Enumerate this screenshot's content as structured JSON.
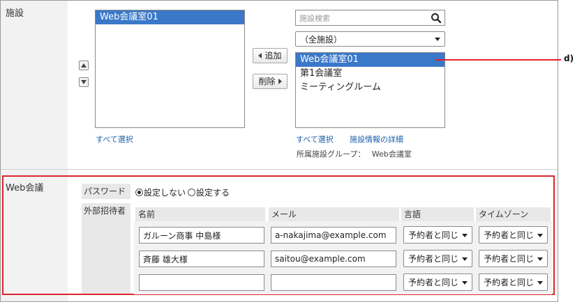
{
  "facility": {
    "row_label": "施設",
    "selected_list": [
      "Web会議室01"
    ],
    "select_all_left": "すべて選択",
    "add_label": "追加",
    "remove_label": "削除",
    "search_placeholder": "施設検索",
    "group_select": "（全施設）",
    "available_list": [
      "Web会議室01",
      "第1会議室",
      "ミーティングルーム"
    ],
    "select_all_right": "すべて選択",
    "facility_details": "施設情報の詳細",
    "group_info_label": "所属施設グループ：",
    "group_info_value": "Web会議室"
  },
  "callout": {
    "label": "d)"
  },
  "web_meeting": {
    "row_label": "Web会議",
    "password": {
      "label": "パスワード",
      "options": [
        "設定しない",
        "設定する"
      ],
      "selected": "設定しない"
    },
    "guests": {
      "label": "外部招待者",
      "headers": [
        "名前",
        "メール",
        "言語",
        "タイムゾーン"
      ],
      "rows": [
        {
          "name": "ガルーン商事 中島様",
          "email": "a-nakajima@example.com",
          "language": "予約者と同じ",
          "timezone": "予約者と同じ"
        },
        {
          "name": "斉藤 雄大様",
          "email": "saitou@example.com",
          "language": "予約者と同じ",
          "timezone": "予約者と同じ"
        },
        {
          "name": "",
          "email": "",
          "language": "予約者と同じ",
          "timezone": "予約者と同じ"
        }
      ]
    }
  },
  "colors": {
    "selection": "#3a78c8",
    "link": "#1a5fa8",
    "highlight_border": "#d9262c",
    "callout_line": "#e0202a"
  }
}
